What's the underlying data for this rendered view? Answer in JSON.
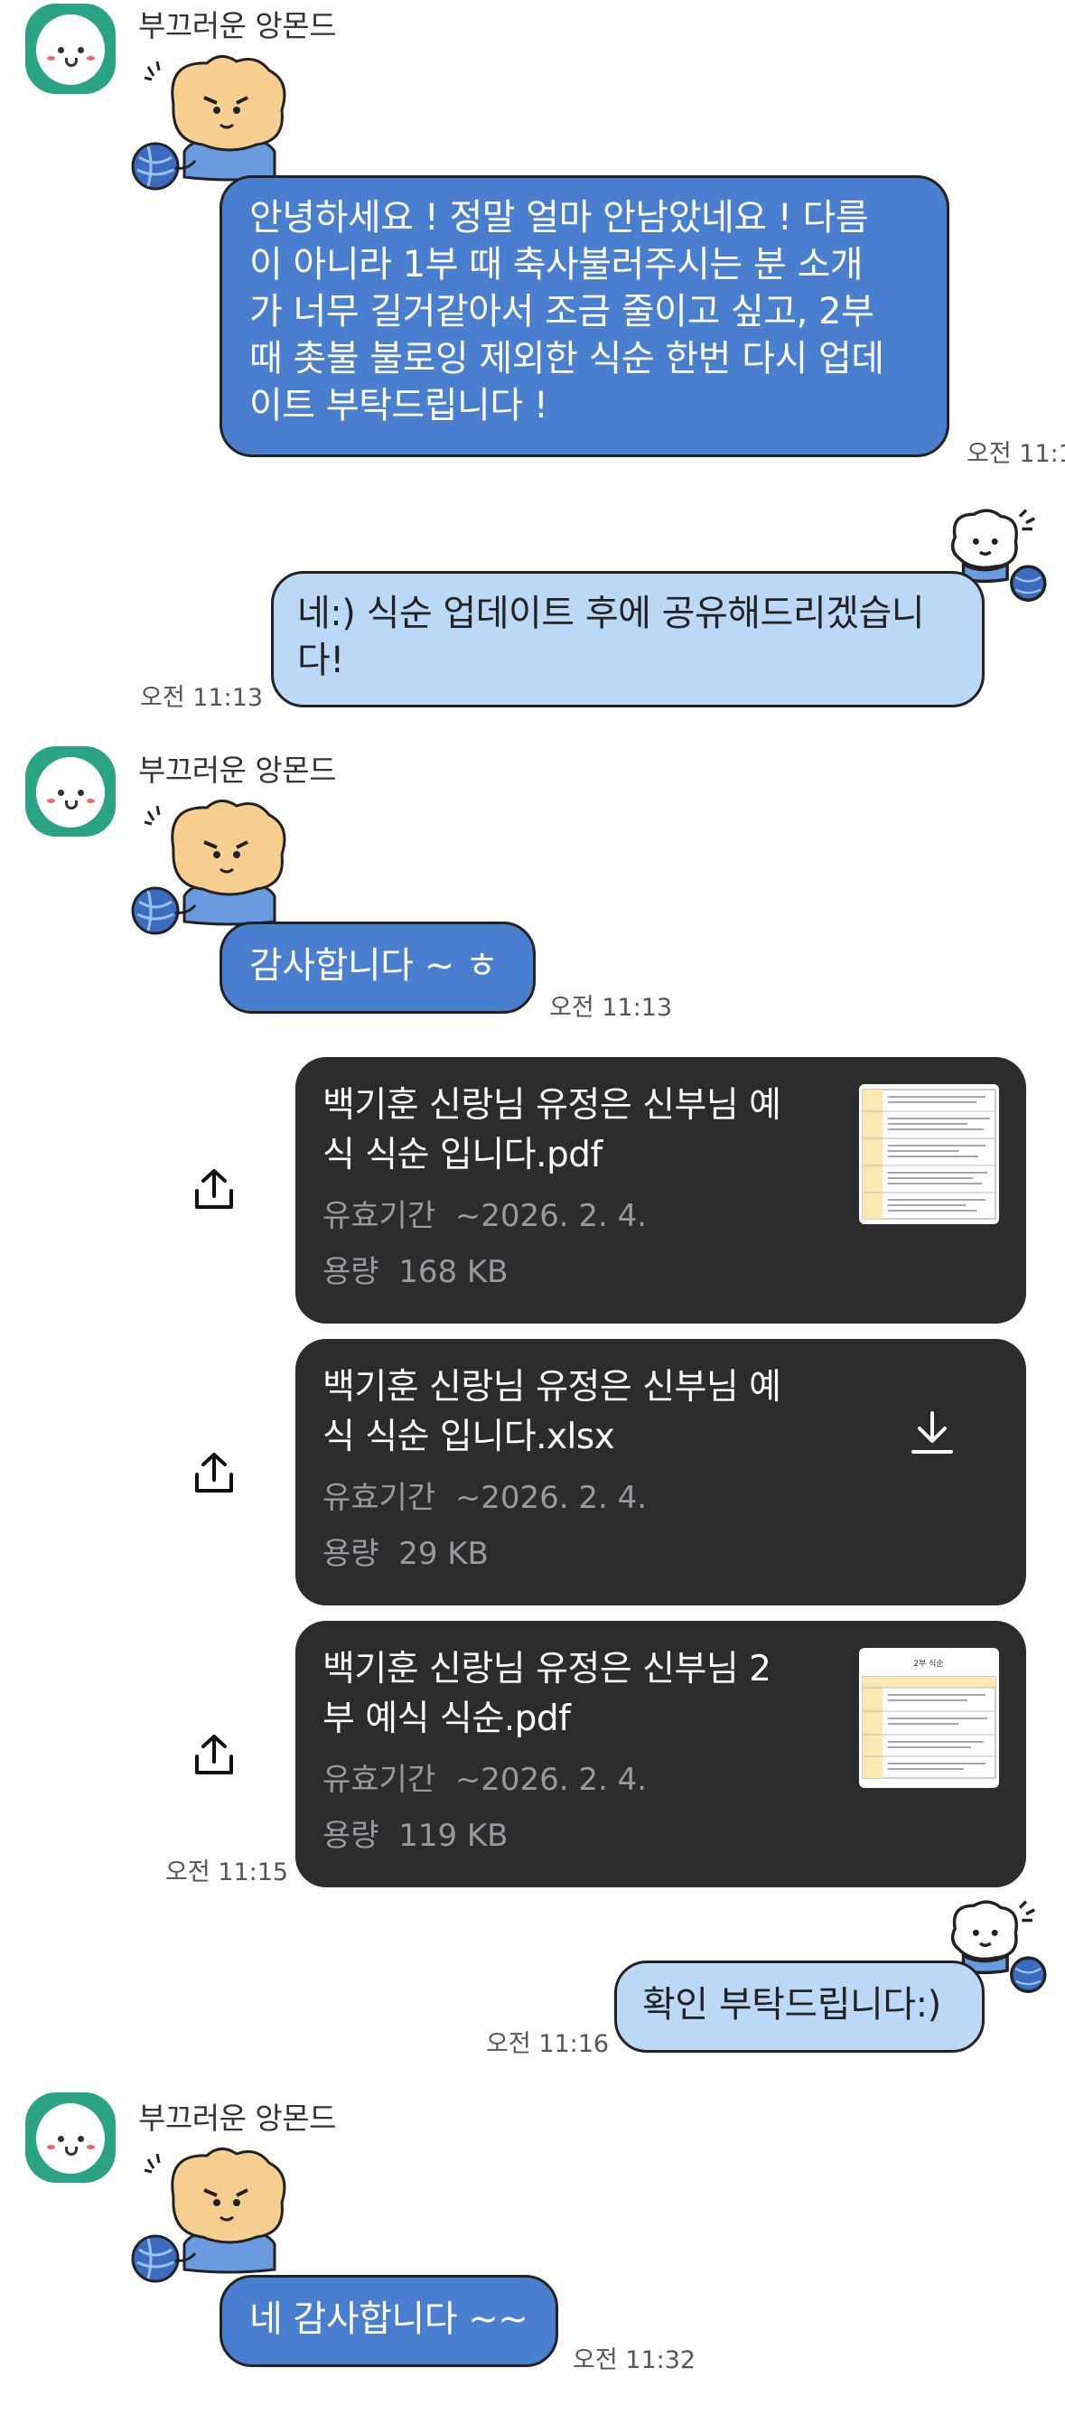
{
  "messages": {
    "group1": {
      "sender": "부끄러운 앙몬드",
      "text": "안녕하세요 ! 정말 얼마 안남았네요 ! 다름\n이 아니라 1부 때 축사불러주시는 분 소개\n가 너무 길거같아서 조금 줄이고 싶고, 2부\n때 촛불 불로잉 제외한 식순 한번 다시 업데\n이트 부탁드립니다 !",
      "time": "오전 11:1"
    },
    "reply1": {
      "text": "네:) 식순 업데이트 후에 공유해드리겠습니\n다!",
      "time": "오전 11:13"
    },
    "group2": {
      "sender": "부끄러운 앙몬드",
      "text": "감사합니다 ~ ㅎ",
      "time": "오전 11:13"
    },
    "files": [
      {
        "name": "백기훈 신랑님 유정은 신부님 예\n식 식순 입니다.pdf",
        "expiry_label": "유효기간",
        "expiry": "~2026. 2. 4.",
        "size_label": "용량",
        "size": "168 KB"
      },
      {
        "name": "백기훈 신랑님 유정은 신부님 예\n식 식순 입니다.xlsx",
        "expiry_label": "유효기간",
        "expiry": "~2026. 2. 4.",
        "size_label": "용량",
        "size": "29 KB"
      },
      {
        "name": "백기훈 신랑님 유정은 신부님 2\n부 예식 식순.pdf",
        "expiry_label": "유효기간",
        "expiry": "~2026. 2. 4.",
        "size_label": "용량",
        "size": "119 KB"
      }
    ],
    "files_time": "오전 11:15",
    "reply2": {
      "text": "확인 부탁드립니다:)",
      "time": "오전 11:16"
    },
    "group3": {
      "sender": "부끄러운 앙몬드",
      "text": "네 감사합니다 ~~",
      "time": "오전 11:32"
    }
  },
  "thumb_doc2_title": "2부 식순",
  "colors": {
    "incoming_bubble": "#4a7fd0",
    "outgoing_bubble": "#bcd8f7",
    "file_card": "#2c2c2e",
    "avatar_bg": "#2aa385"
  },
  "icons": [
    "share-icon",
    "download-icon",
    "bear-emoticon",
    "yarn-ball-icon"
  ]
}
